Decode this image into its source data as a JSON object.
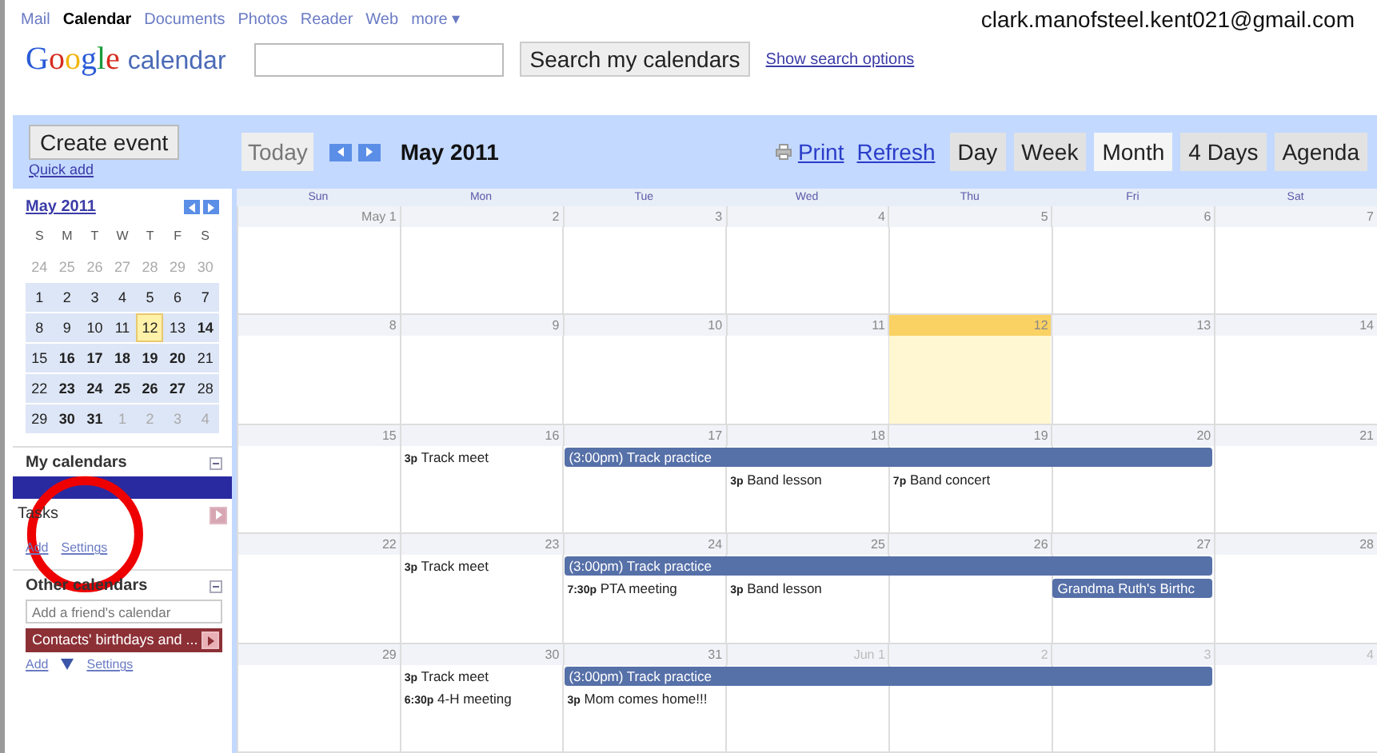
{
  "topnav": {
    "links": [
      {
        "label": "Mail",
        "selected": false
      },
      {
        "label": "Calendar",
        "selected": true
      },
      {
        "label": "Documents",
        "selected": false
      },
      {
        "label": "Photos",
        "selected": false
      },
      {
        "label": "Reader",
        "selected": false
      },
      {
        "label": "Web",
        "selected": false
      },
      {
        "label": "more ▾",
        "selected": false
      }
    ],
    "account": "clark.manofsteel.kent021@gmail.com"
  },
  "header": {
    "logo_word": "Google",
    "logo_product": "calendar",
    "search_button": "Search my calendars",
    "search_options": "Show search options"
  },
  "sidebar": {
    "create_button": "Create event",
    "quick_add": "Quick add",
    "mini_calendar": {
      "title": "May 2011",
      "weekdays": [
        "S",
        "M",
        "T",
        "W",
        "T",
        "F",
        "S"
      ],
      "weeks": [
        {
          "in_view": false,
          "days": [
            {
              "label": "24",
              "other_month": true,
              "busy": false,
              "today": false
            },
            {
              "label": "25",
              "other_month": true,
              "busy": false,
              "today": false
            },
            {
              "label": "26",
              "other_month": true,
              "busy": false,
              "today": false
            },
            {
              "label": "27",
              "other_month": true,
              "busy": false,
              "today": false
            },
            {
              "label": "28",
              "other_month": true,
              "busy": false,
              "today": false
            },
            {
              "label": "29",
              "other_month": true,
              "busy": false,
              "today": false
            },
            {
              "label": "30",
              "other_month": true,
              "busy": false,
              "today": false
            }
          ]
        },
        {
          "in_view": true,
          "days": [
            {
              "label": "1",
              "other_month": false,
              "busy": false,
              "today": false
            },
            {
              "label": "2",
              "other_month": false,
              "busy": false,
              "today": false
            },
            {
              "label": "3",
              "other_month": false,
              "busy": false,
              "today": false
            },
            {
              "label": "4",
              "other_month": false,
              "busy": false,
              "today": false
            },
            {
              "label": "5",
              "other_month": false,
              "busy": false,
              "today": false
            },
            {
              "label": "6",
              "other_month": false,
              "busy": false,
              "today": false
            },
            {
              "label": "7",
              "other_month": false,
              "busy": false,
              "today": false
            }
          ]
        },
        {
          "in_view": true,
          "days": [
            {
              "label": "8",
              "other_month": false,
              "busy": false,
              "today": false
            },
            {
              "label": "9",
              "other_month": false,
              "busy": false,
              "today": false
            },
            {
              "label": "10",
              "other_month": false,
              "busy": false,
              "today": false
            },
            {
              "label": "11",
              "other_month": false,
              "busy": false,
              "today": false
            },
            {
              "label": "12",
              "other_month": false,
              "busy": false,
              "today": true
            },
            {
              "label": "13",
              "other_month": false,
              "busy": false,
              "today": false
            },
            {
              "label": "14",
              "other_month": false,
              "busy": true,
              "today": false
            }
          ]
        },
        {
          "in_view": true,
          "days": [
            {
              "label": "15",
              "other_month": false,
              "busy": false,
              "today": false
            },
            {
              "label": "16",
              "other_month": false,
              "busy": true,
              "today": false
            },
            {
              "label": "17",
              "other_month": false,
              "busy": true,
              "today": false
            },
            {
              "label": "18",
              "other_month": false,
              "busy": true,
              "today": false
            },
            {
              "label": "19",
              "other_month": false,
              "busy": true,
              "today": false
            },
            {
              "label": "20",
              "other_month": false,
              "busy": true,
              "today": false
            },
            {
              "label": "21",
              "other_month": false,
              "busy": false,
              "today": false
            }
          ]
        },
        {
          "in_view": true,
          "days": [
            {
              "label": "22",
              "other_month": false,
              "busy": false,
              "today": false
            },
            {
              "label": "23",
              "other_month": false,
              "busy": true,
              "today": false
            },
            {
              "label": "24",
              "other_month": false,
              "busy": true,
              "today": false
            },
            {
              "label": "25",
              "other_month": false,
              "busy": true,
              "today": false
            },
            {
              "label": "26",
              "other_month": false,
              "busy": true,
              "today": false
            },
            {
              "label": "27",
              "other_month": false,
              "busy": true,
              "today": false
            },
            {
              "label": "28",
              "other_month": false,
              "busy": false,
              "today": false
            }
          ]
        },
        {
          "in_view": true,
          "days": [
            {
              "label": "29",
              "other_month": false,
              "busy": false,
              "today": false
            },
            {
              "label": "30",
              "other_month": false,
              "busy": true,
              "today": false
            },
            {
              "label": "31",
              "other_month": false,
              "busy": true,
              "today": false
            },
            {
              "label": "1",
              "other_month": true,
              "busy": false,
              "today": false
            },
            {
              "label": "2",
              "other_month": true,
              "busy": false,
              "today": false
            },
            {
              "label": "3",
              "other_month": true,
              "busy": false,
              "today": false
            },
            {
              "label": "4",
              "other_month": true,
              "busy": false,
              "today": false
            }
          ]
        }
      ]
    },
    "my_calendars": {
      "title": "My calendars",
      "items": [
        {
          "color": "#2a2aa0"
        },
        {
          "name": "Tasks",
          "color": "#d7a6b3"
        }
      ],
      "links": [
        "Add",
        "Settings"
      ]
    },
    "other_calendars": {
      "title": "Other calendars",
      "placeholder": "Add a friend's calendar",
      "items": [
        {
          "name": "Contacts' birthdays and ...",
          "color": "#8c3036"
        }
      ],
      "links": [
        "Add",
        "Settings"
      ]
    }
  },
  "toolbar": {
    "today": "Today",
    "period": "May 2011",
    "print": "Print",
    "refresh": "Refresh",
    "views": [
      {
        "label": "Day",
        "selected": false
      },
      {
        "label": "Week",
        "selected": false
      },
      {
        "label": "Month",
        "selected": true
      },
      {
        "label": "4 Days",
        "selected": false
      },
      {
        "label": "Agenda",
        "selected": false
      }
    ]
  },
  "month": {
    "weekdays": [
      "Sun",
      "Mon",
      "Tue",
      "Wed",
      "Thu",
      "Fri",
      "Sat"
    ],
    "weeks": [
      {
        "days": [
          {
            "date": "May 1",
            "other_month": false,
            "today": false
          },
          {
            "date": "2",
            "other_month": false,
            "today": false
          },
          {
            "date": "3",
            "other_month": false,
            "today": false
          },
          {
            "date": "4",
            "other_month": false,
            "today": false
          },
          {
            "date": "5",
            "other_month": false,
            "today": false
          },
          {
            "date": "6",
            "other_month": false,
            "today": false
          },
          {
            "date": "7",
            "other_month": false,
            "today": false
          }
        ]
      },
      {
        "days": [
          {
            "date": "8",
            "other_month": false,
            "today": false
          },
          {
            "date": "9",
            "other_month": false,
            "today": false
          },
          {
            "date": "10",
            "other_month": false,
            "today": false
          },
          {
            "date": "11",
            "other_month": false,
            "today": false
          },
          {
            "date": "12",
            "other_month": false,
            "today": true
          },
          {
            "date": "13",
            "other_month": false,
            "today": false
          },
          {
            "date": "14",
            "other_month": false,
            "today": false
          }
        ]
      },
      {
        "days": [
          {
            "date": "15",
            "other_month": false,
            "today": false
          },
          {
            "date": "16",
            "other_month": false,
            "today": false,
            "events": [
              {
                "kind": "timed",
                "time": "3p",
                "title": "Track meet"
              }
            ]
          },
          {
            "date": "17",
            "other_month": false,
            "today": false,
            "events": [
              {
                "kind": "bar",
                "title": "(3:00pm) Track practice"
              }
            ]
          },
          {
            "date": "18",
            "other_month": false,
            "today": false,
            "events": [
              {
                "kind": "continued"
              },
              {
                "kind": "timed",
                "time": "3p",
                "title": "Band lesson"
              }
            ]
          },
          {
            "date": "19",
            "other_month": false,
            "today": false,
            "events": [
              {
                "kind": "continued"
              },
              {
                "kind": "timed",
                "time": "7p",
                "title": "Band concert"
              }
            ]
          },
          {
            "date": "20",
            "other_month": false,
            "today": false,
            "events": [
              {
                "kind": "continued"
              }
            ]
          },
          {
            "date": "21",
            "other_month": false,
            "today": false
          }
        ]
      },
      {
        "days": [
          {
            "date": "22",
            "other_month": false,
            "today": false
          },
          {
            "date": "23",
            "other_month": false,
            "today": false,
            "events": [
              {
                "kind": "timed",
                "time": "3p",
                "title": "Track meet"
              }
            ]
          },
          {
            "date": "24",
            "other_month": false,
            "today": false,
            "events": [
              {
                "kind": "bar",
                "title": "(3:00pm) Track practice"
              },
              {
                "kind": "timed",
                "time": "7:30p",
                "title": "PTA meeting"
              }
            ]
          },
          {
            "date": "25",
            "other_month": false,
            "today": false,
            "events": [
              {
                "kind": "continued"
              },
              {
                "kind": "timed",
                "time": "3p",
                "title": "Band lesson"
              }
            ]
          },
          {
            "date": "26",
            "other_month": false,
            "today": false,
            "events": [
              {
                "kind": "continued"
              }
            ]
          },
          {
            "date": "27",
            "other_month": false,
            "today": false,
            "events": [
              {
                "kind": "continued"
              },
              {
                "kind": "bar",
                "title": "Grandma Ruth's Birthc"
              }
            ]
          },
          {
            "date": "28",
            "other_month": false,
            "today": false
          }
        ]
      },
      {
        "days": [
          {
            "date": "29",
            "other_month": false,
            "today": false
          },
          {
            "date": "30",
            "other_month": false,
            "today": false,
            "events": [
              {
                "kind": "timed",
                "time": "3p",
                "title": "Track meet"
              },
              {
                "kind": "timed",
                "time": "6:30p",
                "title": "4-H meeting"
              }
            ]
          },
          {
            "date": "31",
            "other_month": false,
            "today": false,
            "events": [
              {
                "kind": "bar",
                "title": "(3:00pm) Track practice"
              },
              {
                "kind": "timed",
                "time": "3p",
                "title": "Mom comes home!!!"
              }
            ]
          },
          {
            "date": "Jun 1",
            "other_month": true,
            "today": false,
            "events": [
              {
                "kind": "continued"
              }
            ]
          },
          {
            "date": "2",
            "other_month": true,
            "today": false,
            "events": [
              {
                "kind": "continued"
              }
            ]
          },
          {
            "date": "3",
            "other_month": true,
            "today": false,
            "events": [
              {
                "kind": "continued"
              }
            ]
          },
          {
            "date": "4",
            "other_month": true,
            "today": false
          }
        ]
      }
    ]
  }
}
